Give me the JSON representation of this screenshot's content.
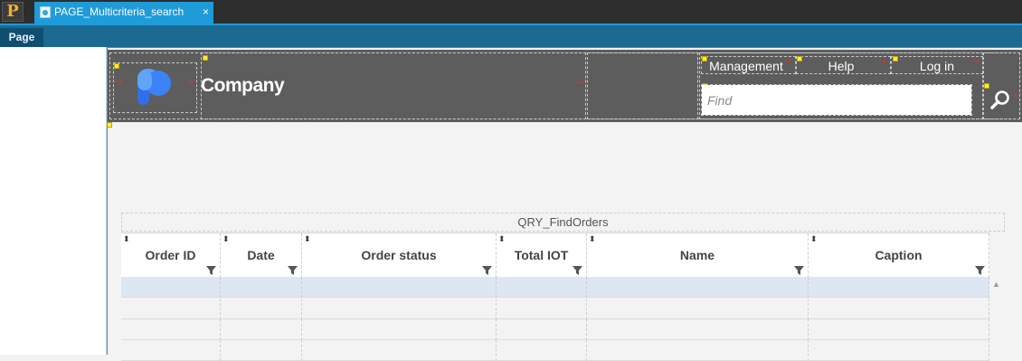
{
  "app": {
    "icon_letter": "P"
  },
  "tabs": [
    {
      "label": "PAGE_Multicriteria_search",
      "close": "×"
    }
  ],
  "subtabs": [
    {
      "label": "Page"
    }
  ],
  "header": {
    "company_name": "Company",
    "logo_icon": "p-logo-icon",
    "menu": [
      {
        "label": "Management"
      },
      {
        "label": "Help"
      },
      {
        "label": "Log in"
      }
    ],
    "search": {
      "placeholder": "Find",
      "value": "",
      "button_icon": "search-icon"
    }
  },
  "table": {
    "title": "QRY_FindOrders",
    "columns": [
      {
        "label": "Order ID"
      },
      {
        "label": "Date"
      },
      {
        "label": "Order status"
      },
      {
        "label": "Total IOT"
      },
      {
        "label": "Name"
      },
      {
        "label": "Caption"
      }
    ],
    "rows": [
      [],
      [],
      [],
      []
    ],
    "selected_row_color": "#dde6f3"
  },
  "colors": {
    "accent": "#1f9bd8",
    "header_background": "#5d5d5d",
    "logo_blue": "#3b82f6"
  }
}
